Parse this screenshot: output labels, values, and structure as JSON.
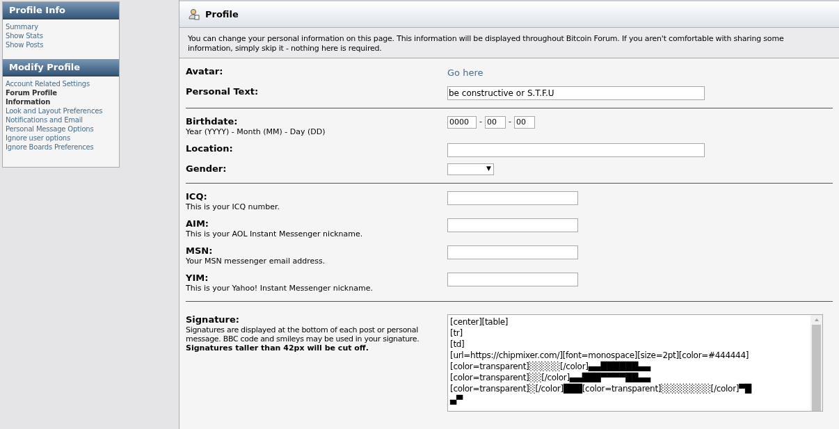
{
  "sidebar": {
    "sections": [
      {
        "title": "Profile Info",
        "items": [
          {
            "label": "Summary",
            "selected": false
          },
          {
            "label": "Show Stats",
            "selected": false
          },
          {
            "label": "Show Posts",
            "selected": false
          }
        ]
      },
      {
        "title": "Modify Profile",
        "items": [
          {
            "label": "Account Related Settings",
            "selected": false
          },
          {
            "label": "Forum Profile Information",
            "selected": true
          },
          {
            "label": "Look and Layout Preferences",
            "selected": false
          },
          {
            "label": "Notifications and Email",
            "selected": false
          },
          {
            "label": "Personal Message Options",
            "selected": false
          },
          {
            "label": "Ignore user options",
            "selected": false
          },
          {
            "label": "Ignore Boards Preferences",
            "selected": false
          }
        ]
      }
    ]
  },
  "profile": {
    "title": "Profile",
    "intro": "You can change your personal information on this page. This information will be displayed throughout Bitcoin Forum. If you aren't comfortable with sharing some information, simply skip it - nothing here is required.",
    "groups": [
      [
        {
          "kind": "link",
          "label": "Avatar:",
          "link": "Go here"
        },
        {
          "kind": "wide_text",
          "label": "Personal Text:",
          "value": "be constructive or S.T.F.U"
        }
      ],
      [
        {
          "kind": "date",
          "label": "Birthdate:",
          "description": "Year (YYYY) - Month (MM) - Day (DD)",
          "parts": [
            "0000",
            "00",
            "00"
          ],
          "separators": [
            "-",
            "-"
          ]
        },
        {
          "kind": "wide_text",
          "label": "Location:"
        },
        {
          "kind": "select",
          "label": "Gender:",
          "caret": "▼"
        }
      ],
      [
        {
          "kind": "short_text",
          "label": "ICQ:",
          "description": "This is your ICQ number."
        },
        {
          "kind": "short_text",
          "label": "AIM:",
          "description": "This is your AOL Instant Messenger nickname."
        },
        {
          "kind": "short_text",
          "label": "MSN:",
          "description": "Your MSN messenger email address."
        },
        {
          "kind": "short_text",
          "label": "YIM:",
          "description": "This is your Yahoo! Instant Messenger nickname."
        }
      ]
    ],
    "signature": {
      "label": "Signature:",
      "description": "Signatures are displayed at the bottom of each post or personal message. BBC code and smileys may be used in your signature.",
      "warning": "Signatures taller than 42px will be cut off.",
      "lines": [
        "[center][table]",
        "[tr]",
        "[td]",
        "[url=https://chipmixer.com/][font=monospace][size=2pt][color=#444444]",
        "[color=transparent]░░░░░[/color]▄▄██████▄▄",
        "[color=transparent]░░[/color]▄▄███▀▀▀▀██▄▄",
        "[color=transparent]░[/color]███[color=transparent]░░░░░░░░[/color]▀█",
        "▄▀"
      ]
    }
  }
}
